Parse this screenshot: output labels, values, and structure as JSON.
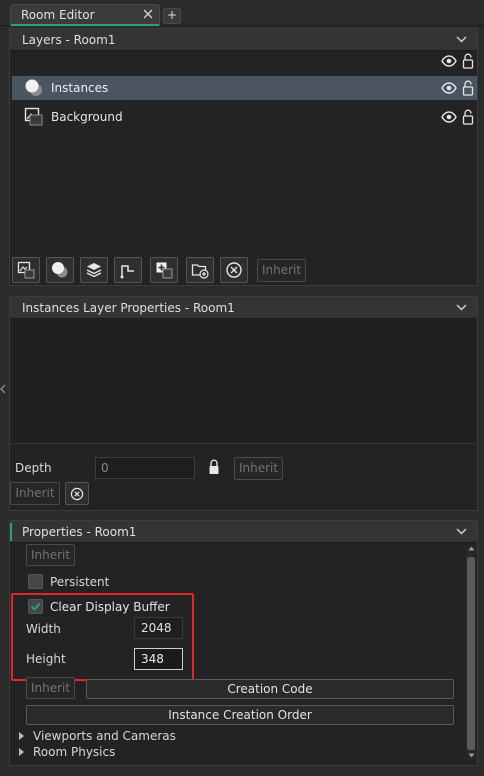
{
  "tabs": {
    "active_label": "Room Editor",
    "new_tab_symbol": "+"
  },
  "layers_panel": {
    "header": "Layers - Room1",
    "items": [
      {
        "label": "Instances",
        "selected": true
      },
      {
        "label": "Background",
        "selected": false
      }
    ],
    "toolbar": {
      "inherit_label": "Inherit"
    }
  },
  "layer_props_panel": {
    "header": "Instances Layer Properties - Room1",
    "depth_label": "Depth",
    "depth_value": "0",
    "inherit_label": "Inherit"
  },
  "room_props_panel": {
    "header": "Properties - Room1",
    "inherit_label": "Inherit",
    "persistent_label": "Persistent",
    "clear_display_buffer_label": "Clear Display Buffer",
    "width_label": "Width",
    "width_value": "2048",
    "height_label": "Height",
    "height_value": "348",
    "creation_code_label": "Creation Code",
    "instance_creation_order_label": "Instance Creation Order",
    "viewports_label": "Viewports and Cameras",
    "physics_label": "Room Physics"
  },
  "colors": {
    "accent": "#2e9e7f",
    "highlight": "#e0262a",
    "selection": "#4b5562"
  }
}
